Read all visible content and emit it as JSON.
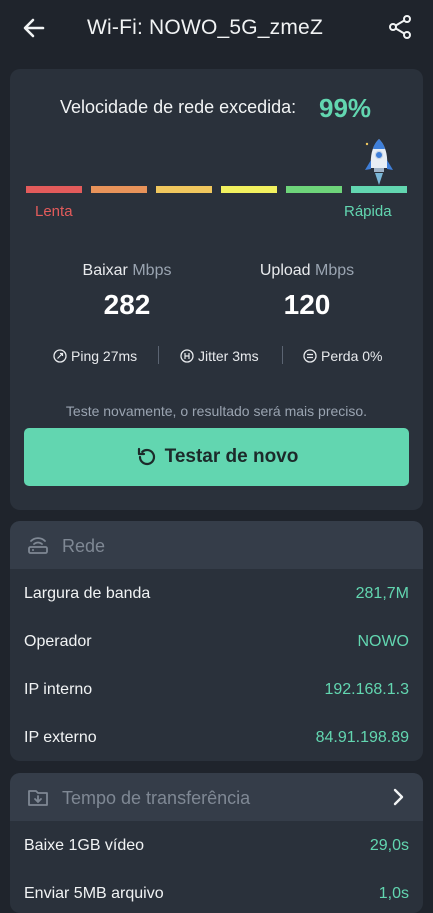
{
  "header": {
    "title": "Wi-Fi: NOWO_5G_zmeZ",
    "back_icon": "arrow-left-icon",
    "share_icon": "share-icon"
  },
  "speed_card": {
    "headline": "Velocidade de rede excedida:",
    "percent": "99%",
    "scale": {
      "segments": [
        "#e35b5b",
        "#e8935a",
        "#f0c75e",
        "#f2f15f",
        "#6ed47a",
        "#62d6b0"
      ],
      "slow_label": "Lenta",
      "fast_label": "Rápida",
      "position_fraction": 0.99
    },
    "download": {
      "label": "Baixar",
      "unit": "Mbps",
      "value": "282"
    },
    "upload": {
      "label": "Upload",
      "unit": "Mbps",
      "value": "120"
    },
    "metrics": [
      {
        "icon": "ping-icon",
        "text": "Ping 27ms"
      },
      {
        "icon": "jitter-icon",
        "text": "Jitter 3ms"
      },
      {
        "icon": "loss-icon",
        "text": "Perda 0%"
      }
    ],
    "hint": "Teste novamente, o resultado será mais preciso.",
    "retest_button": "Testar de novo"
  },
  "network_card": {
    "title": "Rede",
    "rows": [
      {
        "label": "Largura de banda",
        "value": "281,7M"
      },
      {
        "label": "Operador",
        "value": "NOWO"
      },
      {
        "label": "IP interno",
        "value": "192.168.1.3"
      },
      {
        "label": "IP externo",
        "value": "84.91.198.89"
      }
    ]
  },
  "transfer_card": {
    "title": "Tempo de transferência",
    "rows": [
      {
        "label": "Baixe 1GB vídeo",
        "value": "29,0s"
      },
      {
        "label": "Enviar 5MB arquivo",
        "value": "1,0s"
      }
    ]
  },
  "colors": {
    "accent": "#62d6b0",
    "background": "#1f242c",
    "card": "#2a313b",
    "card_header": "#353d49"
  }
}
